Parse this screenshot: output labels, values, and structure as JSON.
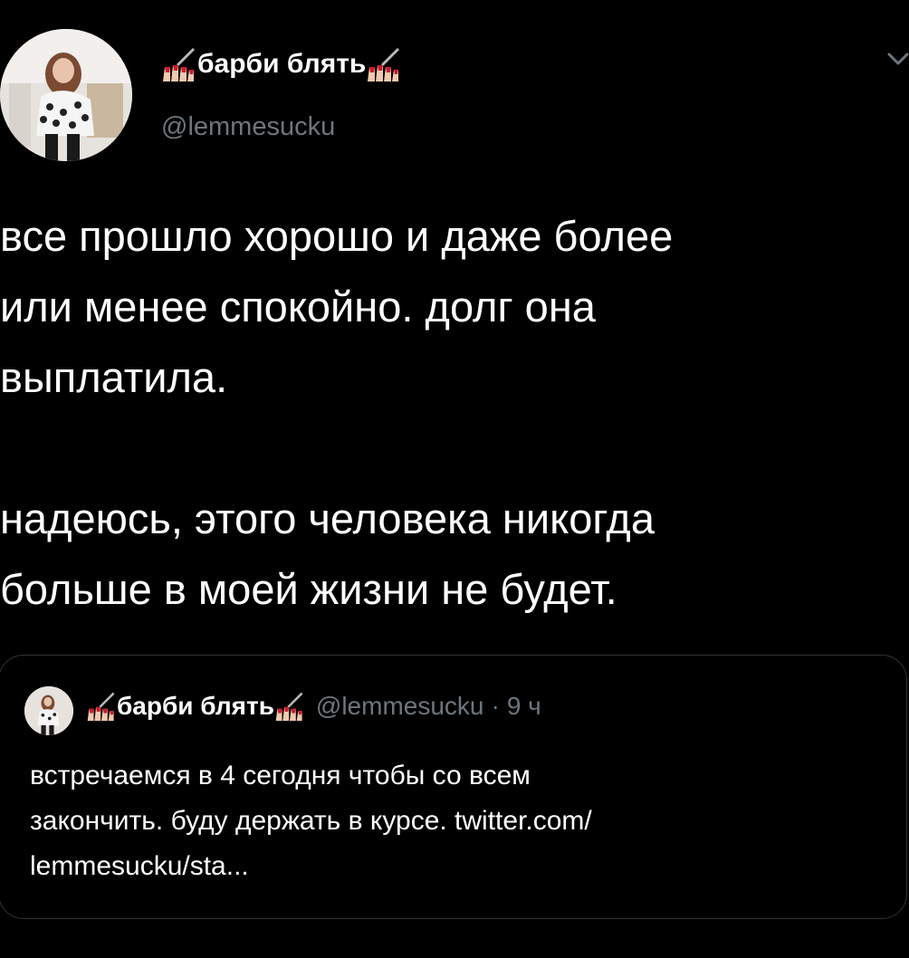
{
  "tweet": {
    "author": {
      "display_name": "барби блять",
      "handle": "@lemmesucku",
      "name_decoration_icon": "nail-polish-icon"
    },
    "text": "все прошло хорошо и даже более\nили менее спокойно. долг она\nвыплатила.\n\nнадеюсь, этого человека никогда\nбольше в моей жизни не будет.",
    "menu_icon": "chevron-down-icon"
  },
  "quoted_tweet": {
    "author": {
      "display_name": "барби блять",
      "handle": "@lemmesucku",
      "name_decoration_icon": "nail-polish-icon"
    },
    "separator": "·",
    "time": "9 ч",
    "text": "встречаемся в 4 сегодня чтобы со всем\nзакончить. буду держать в курсе. twitter.com/\nlemmesucku/sta..."
  },
  "colors": {
    "background": "#000000",
    "primary_text": "#ffffff",
    "secondary_text": "#6e767d",
    "border": "#2f3336",
    "nail_red": "#d0192b"
  }
}
